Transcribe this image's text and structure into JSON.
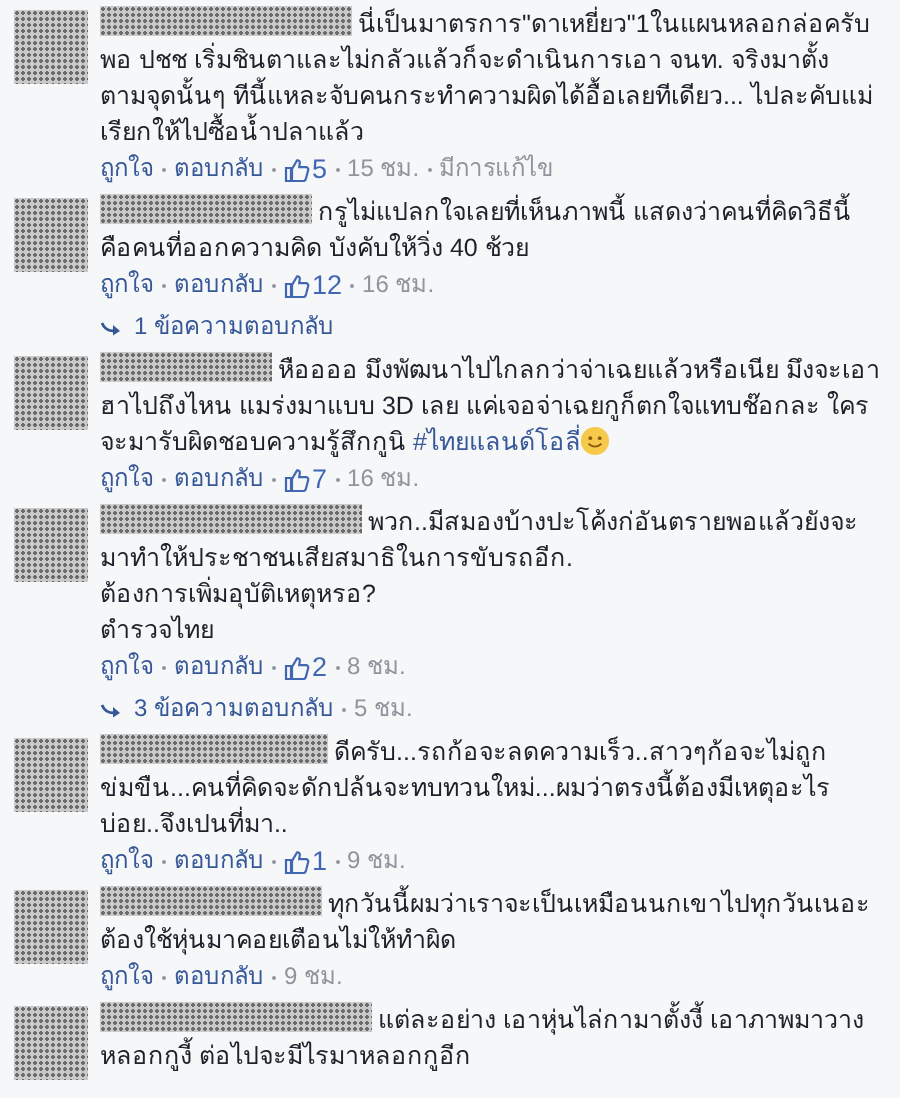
{
  "comments": [
    {
      "text": "นี่เป็นมาตรการ\"ดาเหยี่ยว\"1ในแผนหลอกล่อครับ พอ ปชช เริ่มชินตาและไม่กลัวแล้วก็จะดำเนินการเอา จนท. จริงมาตั้ง ตามจุดนั้นๆ ทีนี้แหละจับคนกระทำความผิดได้อื้อเลยทีเดียว... ไปละคับแม่เรียกให้ไปซื้อน้ำปลาแล้ว",
      "actions": {
        "like": "ถูกใจ",
        "reply": "ตอบกลับ",
        "likes": "5",
        "time": "15 ชม.",
        "edited": "มีการแก้ไข"
      }
    },
    {
      "text": "กรูไม่แปลกใจเลยที่เห็นภาพนี้ แสดงว่าคนที่คิดวิธีนี้คือคนที่ออกความคิด บังคับให้วิ่ง 40 ช้วย",
      "actions": {
        "like": "ถูกใจ",
        "reply": "ตอบกลับ",
        "likes": "12",
        "time": "16 ชม."
      },
      "replies": {
        "label": "1 ข้อความตอบกลับ"
      }
    },
    {
      "text": "หืออออ มึงพัฒนาไปไกลกว่าจ่าเฉยแล้วหรือเนีย มึงจะเอาฮาไปถึงไหน แมร่งมาแบบ 3D เลย แค่เจอจ่าเฉยกูก็ตกใจแทบช๊อกละ ใครจะมารับผิดชอบความรู้สึกกูนิ",
      "hashtag": "#ไทยแลนด์โอลี่",
      "emoji": {
        "kind": "smiley"
      },
      "actions": {
        "like": "ถูกใจ",
        "reply": "ตอบกลับ",
        "likes": "7",
        "time": "16 ชม."
      }
    },
    {
      "text": "พวก..มีสมองบ้างปะโค้งก่อันตรายพอแล้วยังจะมาทำให้ประชาชนเสียสมาธิในการขับรถอีก.\nต้องการเพิ่มอุบัติเหตุหรอ?\nตำรวจไทย",
      "actions": {
        "like": "ถูกใจ",
        "reply": "ตอบกลับ",
        "likes": "2",
        "time": "8 ชม."
      },
      "replies": {
        "label": "3 ข้อความตอบกลับ",
        "time": "5 ชม."
      }
    },
    {
      "text": "ดีครับ...รถก้อจะลดความเร็ว..สาวๆก้อจะไม่ถูกข่มขืน...คนที่คิดจะดักปล้นจะทบทวนใหม่...ผมว่าตรงนี้ต้องมีเหตุอะไรบ่อย..จึงเปนที่มา..",
      "actions": {
        "like": "ถูกใจ",
        "reply": "ตอบกลับ",
        "likes": "1",
        "time": "9 ชม."
      }
    },
    {
      "text": "ทุกวันนี้ผมว่าเราจะเป็นเหมือนนกเขาไปทุกวันเนอะ ต้องใช้หุ่นมาคอยเตือนไม่ให้ทำผิด",
      "actions": {
        "like": "ถูกใจ",
        "reply": "ตอบกลับ",
        "time": "9 ชม."
      }
    },
    {
      "text": "แต่ละอย่าง เอาหุ่นไล่กามาตั้งงี้ เอาภาพมาวางหลอกกูงี้ ต่อไปจะมีไรมาหลอกกูอีก"
    }
  ]
}
